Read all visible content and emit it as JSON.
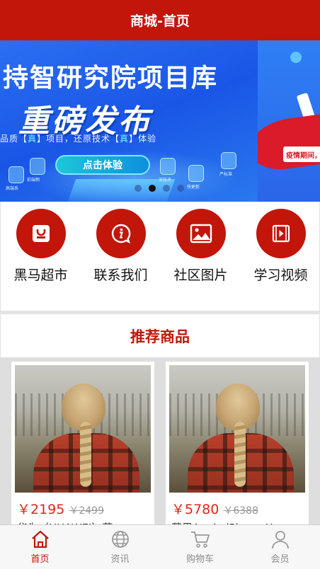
{
  "header": {
    "title": "商城-首页"
  },
  "banner": {
    "title_line1": "持智研究院项目库",
    "title_line2": "重磅发布",
    "subtitle_parts": [
      "品质【",
      "真",
      "】项目，还原技术【",
      "真",
      "】体验"
    ],
    "cta_label": "点击体验",
    "chip_labels": [
      "高端系",
      "前端侧",
      "深技术",
      "快更新",
      "严标准"
    ],
    "side_tag": "疫情期间，",
    "dots_count": 4,
    "active_dot": 1
  },
  "quicknav": {
    "items": [
      {
        "label": "黑马超市",
        "icon": "shopping-bag-icon"
      },
      {
        "label": "联系我们",
        "icon": "info-chat-icon"
      },
      {
        "label": "社区图片",
        "icon": "picture-icon"
      },
      {
        "label": "学习视频",
        "icon": "video-play-icon"
      }
    ]
  },
  "recommend": {
    "title": "推荐商品",
    "products": [
      {
        "price": "￥2195",
        "old_price": "￥2499",
        "name": "华为（HUAWEI）荣"
      },
      {
        "price": "￥5780",
        "old_price": "￥6388",
        "name": "苹果Apple iPhone X"
      }
    ]
  },
  "tabbar": {
    "items": [
      {
        "label": "首页",
        "icon": "home-icon",
        "active": true
      },
      {
        "label": "资讯",
        "icon": "globe-icon",
        "active": false
      },
      {
        "label": "购物车",
        "icon": "cart-icon",
        "active": false
      },
      {
        "label": "会员",
        "icon": "user-icon",
        "active": false
      }
    ]
  },
  "colors": {
    "brand": "#c2160b",
    "price": "#e1251b",
    "muted": "#8c8c8c"
  }
}
